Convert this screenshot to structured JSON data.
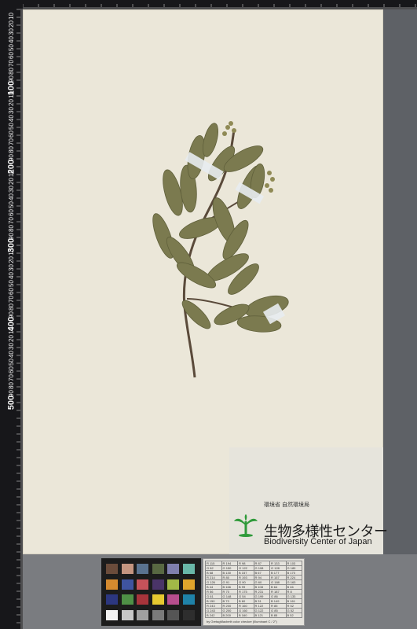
{
  "scene": {
    "subject": "herbarium-sheet",
    "colors": {
      "paper": "#ebe7d9",
      "ruler": "#17171a",
      "leaf": "#7b7a4f",
      "leaf_dark": "#5f5f3a",
      "stem": "#5a4a3a",
      "label_tag": "#e8ecef"
    }
  },
  "ruler": {
    "major_labels": [
      "100",
      "200",
      "300",
      "400",
      "500"
    ],
    "minor_labels": [
      "10",
      "20",
      "30",
      "40",
      "50",
      "60",
      "70",
      "80",
      "90"
    ]
  },
  "institution": {
    "agency": "環境省 自然環境局",
    "name_jp": "生物多様性センター",
    "name_en": "Biodiversity Center of Japan",
    "logo_icon": "tree-logo-icon"
  },
  "color_chart": {
    "patches": [
      "#6b4c3b",
      "#c49580",
      "#5a7390",
      "#586842",
      "#7f7fae",
      "#69b7a8",
      "#d48a2f",
      "#3f54a0",
      "#c5525a",
      "#4a3468",
      "#a2b847",
      "#e0a52c",
      "#2c3780",
      "#4f9046",
      "#a8343b",
      "#e6c930",
      "#b74e8e",
      "#1f82a8",
      "#f2f2f2",
      "#c8c8c8",
      "#a0a0a0",
      "#7a7a7a",
      "#555555",
      "#2e2e2e"
    ],
    "reference_caption": "by GretagMacbeth color checker (Illuminant C / 2°)",
    "reference_rows": [
      [
        "R 115",
        "R 194",
        "R 98",
        "R 87",
        "R 133",
        "R 103"
      ],
      [
        "G 82",
        "G 150",
        "G 122",
        "G 108",
        "G 128",
        "G 189"
      ],
      [
        "B 68",
        "B 130",
        "B 157",
        "B 67",
        "B 177",
        "B 170"
      ],
      [
        "R 214",
        "R 80",
        "R 193",
        "R 94",
        "R 157",
        "R 224"
      ],
      [
        "G 126",
        "G 91",
        "G 90",
        "G 60",
        "G 188",
        "G 163"
      ],
      [
        "B 44",
        "B 166",
        "B 99",
        "B 108",
        "B 64",
        "B 46"
      ],
      [
        "R 56",
        "R 70",
        "R 175",
        "R 231",
        "R 187",
        "R 8"
      ],
      [
        "G 61",
        "G 148",
        "G 54",
        "G 199",
        "G 86",
        "G 133"
      ],
      [
        "B 150",
        "B 73",
        "B 60",
        "B 31",
        "B 149",
        "B 161"
      ],
      [
        "R 243",
        "R 200",
        "R 160",
        "R 122",
        "R 85",
        "R 52"
      ],
      [
        "G 243",
        "G 200",
        "G 160",
        "G 122",
        "G 85",
        "G 52"
      ],
      [
        "B 242",
        "B 200",
        "B 160",
        "B 121",
        "B 85",
        "B 52"
      ]
    ]
  }
}
